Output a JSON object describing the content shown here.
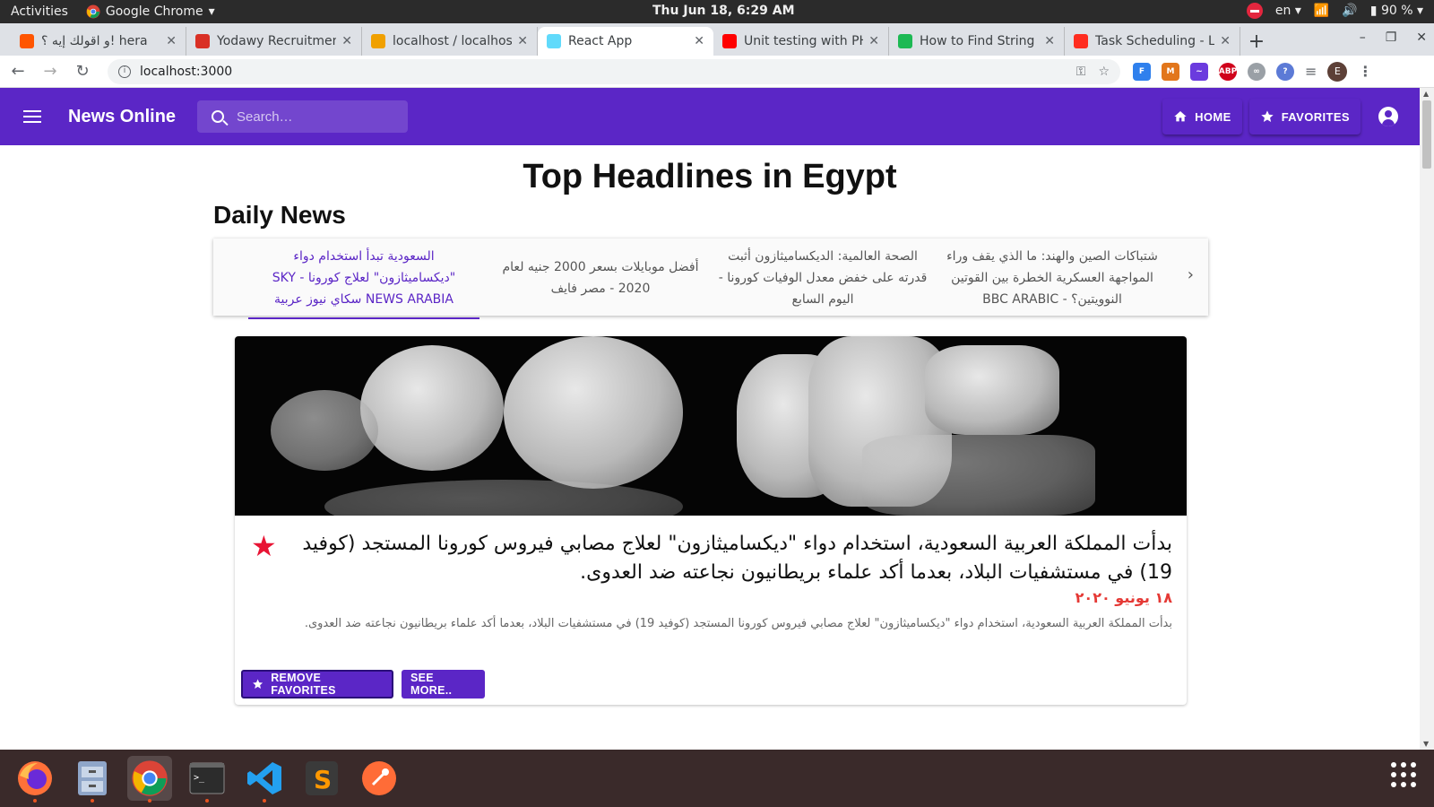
{
  "system": {
    "activities": "Activities",
    "app_name": "Google Chrome",
    "clock": "Thu Jun 18,  6:29 AM",
    "lang": "en",
    "battery": "90 %"
  },
  "browser": {
    "tabs": [
      {
        "label": "و اقولك إيه ؟! hera",
        "icon": "soundcloud-icon",
        "color": "#ff5500"
      },
      {
        "label": "Yodawy Recruitmen",
        "icon": "gmail-icon",
        "color": "#d93025"
      },
      {
        "label": "localhost / localhost",
        "icon": "phpmyadmin-icon",
        "color": "#f0a000"
      },
      {
        "label": "React App",
        "icon": "react-icon",
        "color": "#61dafb"
      },
      {
        "label": "Unit testing with PH",
        "icon": "youtube-icon",
        "color": "#ff0000"
      },
      {
        "label": "How to Find String I",
        "icon": "hashnode-icon",
        "color": "#1db954"
      },
      {
        "label": "Task Scheduling - La",
        "icon": "laravel-icon",
        "color": "#ff2d20"
      }
    ],
    "url": "localhost:3000"
  },
  "app": {
    "brand": "News Online",
    "search_placeholder": "Search…",
    "nav": {
      "home": "HOME",
      "favorites": "FAVORITES"
    },
    "accent": "#5b26c6"
  },
  "main": {
    "page_title": "Top Headlines in Egypt",
    "section_title": "Daily News",
    "carousel": [
      {
        "title": "السعودية تبدأ استخدام دواء \"ديكساميثازون\" لعلاج كورونا - SKY NEWS ARABIA سكاي نيوز عربية",
        "active": true
      },
      {
        "title": "أفضل موبايلات بسعر 2000 جنيه لعام 2020 - مصر فايف",
        "active": false
      },
      {
        "title": "الصحة العالمية: الديكساميثازون أثبت قدرته على خفض معدل الوفيات كورونا - اليوم السابع",
        "active": false
      },
      {
        "title": "شتباكات الصين والهند: ما الذي يقف وراء المواجهة العسكرية الخطرة بين القوتين النوويتين؟ - BBC ARABIC",
        "active": false
      }
    ],
    "article": {
      "headline": "بدأت المملكة العربية السعودية، استخدام دواء \"ديكساميثازون\" لعلاج مصابي فيروس كورونا المستجد (كوفيد 19) في مستشفيات البلاد، بعدما أكد علماء بريطانيون نجاعته ضد العدوى.",
      "date": "١٨ يونيو ٢٠٢٠",
      "description": "بدأت المملكة العربية السعودية، استخدام دواء \"ديكساميثازون\" لعلاج مصابي فيروس كورونا المستجد (كوفيد 19) في مستشفيات البلاد، بعدما أكد علماء بريطانيون نجاعته ضد العدوى.",
      "remove_label": "REMOVE FAVORITES",
      "more_label": "SEE MORE.."
    }
  }
}
